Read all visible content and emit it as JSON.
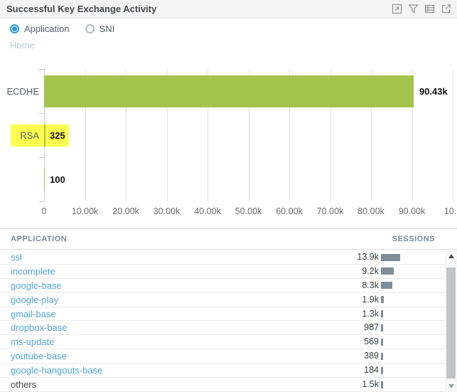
{
  "widget": {
    "title": "Successful Key Exchange Activity",
    "icons": [
      "maximize-icon",
      "filter-icon",
      "table-icon",
      "export-icon"
    ]
  },
  "controls": {
    "options": [
      {
        "label": "Application",
        "selected": true
      },
      {
        "label": "SNI",
        "selected": false
      }
    ]
  },
  "breadcrumb": {
    "home": "Home"
  },
  "chart_data": {
    "type": "bar",
    "orientation": "horizontal",
    "title": "",
    "categories": [
      "ECDHE",
      "RSA",
      ""
    ],
    "values": [
      90430,
      325,
      100
    ],
    "value_labels": [
      "90.43k",
      "325",
      "100"
    ],
    "highlighted_category": "RSA",
    "x_ticks": [
      "0",
      "10.00k",
      "20.00k",
      "30.00k",
      "40.00k",
      "50.00k",
      "60.00k",
      "70.00k",
      "80.00k",
      "90.00k",
      "10..."
    ],
    "xlim": [
      0,
      100000
    ],
    "grid": true,
    "bar_color": "#a3c24e",
    "highlight_color": "#fdff4f"
  },
  "table": {
    "columns": [
      "APPLICATION",
      "SESSIONS"
    ],
    "bar_color": "#7f8d99",
    "rows": [
      {
        "application": "ssl",
        "sessions": "13.9k",
        "value": 13900,
        "link": true
      },
      {
        "application": "incomplete",
        "sessions": "9.2k",
        "value": 9200,
        "link": true
      },
      {
        "application": "google-base",
        "sessions": "8.3k",
        "value": 8300,
        "link": true
      },
      {
        "application": "google-play",
        "sessions": "1.9k",
        "value": 1900,
        "link": true
      },
      {
        "application": "gmail-base",
        "sessions": "1.3k",
        "value": 1300,
        "link": true
      },
      {
        "application": "dropbox-base",
        "sessions": "987",
        "value": 987,
        "link": true
      },
      {
        "application": "ms-update",
        "sessions": "569",
        "value": 569,
        "link": true
      },
      {
        "application": "youtube-base",
        "sessions": "389",
        "value": 389,
        "link": true
      },
      {
        "application": "google-hangouts-base",
        "sessions": "184",
        "value": 184,
        "link": true
      },
      {
        "application": "others",
        "sessions": "1.5k",
        "value": 1500,
        "link": false
      }
    ]
  },
  "colors": {
    "radio_selected": "#2a9fdb",
    "link": "#55a5d9",
    "breadcrumb": "#b9cfda",
    "titlebar_bg": "#f4f4f4"
  }
}
